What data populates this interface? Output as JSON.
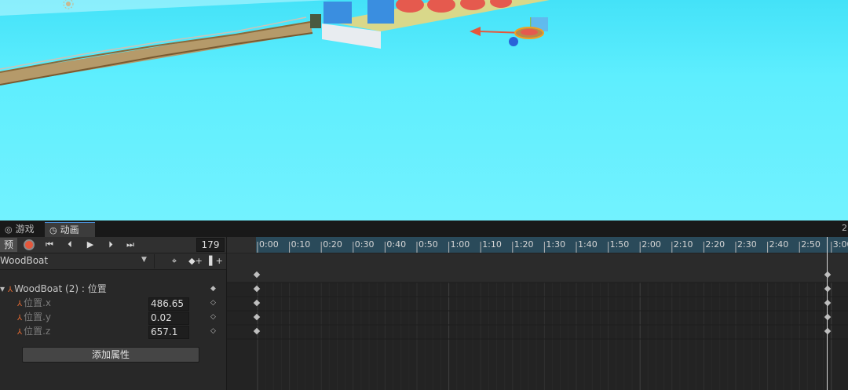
{
  "tabs": [
    {
      "label": "游戏",
      "icon": "gamepad-icon"
    },
    {
      "label": "动画",
      "icon": "clock-icon"
    }
  ],
  "tab_corner": "2",
  "toolbar": {
    "preview_label": "预览",
    "first_key": "⏮",
    "prev_key": "⏴",
    "play": "▶",
    "next_key": "⏵",
    "last_key": "⏭",
    "frame": "179"
  },
  "clip": {
    "name": "WoodBoat",
    "dropdown": "▼",
    "tool_key": "⌖",
    "tool_add_key": "◆+",
    "tool_add_event": "▌+"
  },
  "properties": {
    "group_label": "WoodBoat (2) : 位置",
    "rows": [
      {
        "label": "位置.x",
        "value": "486.65"
      },
      {
        "label": "位置.y",
        "value": "0.02"
      },
      {
        "label": "位置.z",
        "value": "657.1"
      }
    ]
  },
  "add_property_label": "添加属性",
  "timeline": {
    "ticks": [
      "0:00",
      "0:10",
      "0:20",
      "0:30",
      "0:40",
      "0:50",
      "1:00",
      "1:10",
      "1:20",
      "1:30",
      "1:40",
      "1:50",
      "2:00",
      "2:10",
      "2:20",
      "2:30",
      "2:40",
      "2:50",
      "3:00"
    ],
    "keyframe_times": [
      "0:00",
      "2:59"
    ],
    "playhead_frame": 179
  },
  "colors": {
    "sky": "#5eeefe",
    "panel": "#282828",
    "ruler_band": "#2a4a5a",
    "record": "#e5573b",
    "axis_icon": "#e66b32"
  }
}
